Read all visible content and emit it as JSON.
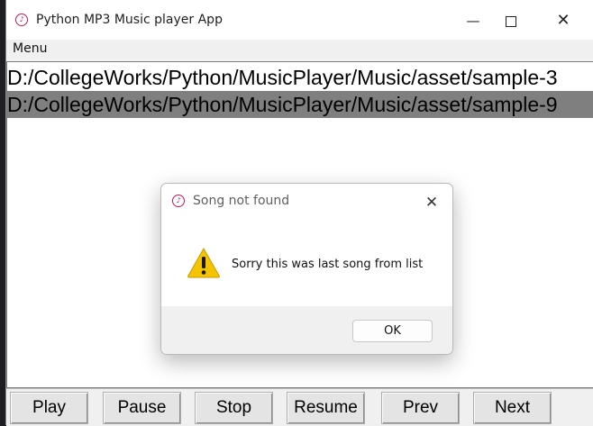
{
  "window": {
    "title": "Python MP3 Music player App",
    "minimize_icon": "minimize-icon",
    "maximize_icon": "maximize-icon",
    "close_icon": "close-icon"
  },
  "menu": {
    "label": "Menu"
  },
  "playlist": {
    "items": [
      "D:/CollegeWorks/Python/MusicPlayer/Music/asset/sample-3",
      "D:/CollegeWorks/Python/MusicPlayer/Music/asset/sample-9"
    ],
    "selected_index": 1
  },
  "controls": {
    "play": "Play",
    "pause": "Pause",
    "stop": "Stop",
    "resume": "Resume",
    "prev": "Prev",
    "next": "Next"
  },
  "dialog": {
    "title": "Song not found",
    "message": "Sorry this was last song from list",
    "ok_label": "OK",
    "icon": "warning-icon"
  },
  "colors": {
    "selection": "#7f7f7f",
    "warning_yellow": "#f5c400",
    "app_icon": "#c2185b"
  }
}
